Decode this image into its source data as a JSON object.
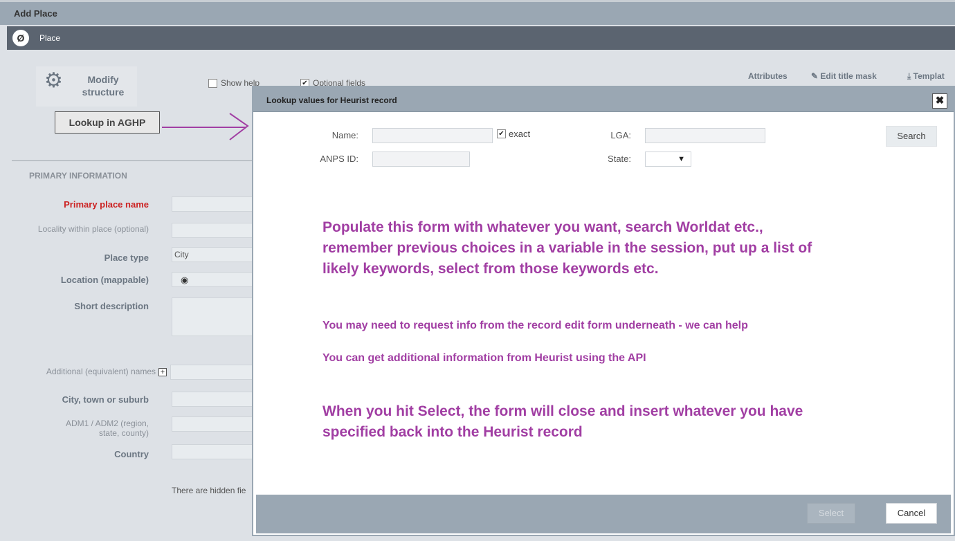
{
  "window": {
    "title": "Add Place"
  },
  "record_bar": {
    "icon_text": "Ø",
    "label": "Place"
  },
  "left_panel": {
    "modify_label": "Modify structure",
    "lookup_button": "Lookup in AGHP",
    "show_help_label": "Show help",
    "optional_fields_label": "Optional fields",
    "section_header": "PRIMARY INFORMATION",
    "fields": {
      "primary_place_name": "Primary place name",
      "locality": "Locality within place (optional)",
      "place_type": "Place type",
      "place_type_value": "City",
      "location": "Location (mappable)",
      "short_description": "Short description",
      "additional_names": "Additional (equivalent) names",
      "city_town_suburb": "City, town or suburb",
      "adm": "ADM1 / ADM2 (region, state, county)",
      "country": "Country"
    },
    "hidden_note": "There are hidden fie"
  },
  "toolbar_right": {
    "attributes": "Attributes",
    "edit_title_mask": "Edit title mask",
    "template": "Templat"
  },
  "dialog": {
    "title": "Lookup values for Heurist record",
    "close_glyph": "✖",
    "search": {
      "name_label": "Name:",
      "exact_label": "exact",
      "anps_label": "ANPS ID:",
      "lga_label": "LGA:",
      "state_label": "State:",
      "state_arrow": "▼",
      "search_button": "Search"
    },
    "messages": {
      "line1": "Populate this form with whatever you want, search Worldat etc.,",
      "line2": "remember previous choices in a variable in the session, put up a list of",
      "line3": "likely keywords, select from those keywords etc.",
      "line4": "You may need to request info from the record edit form underneath - we can help",
      "line5": "You can get additional information from Heurist using the API",
      "line6": "When you hit Select, the form will close and insert whatever you have",
      "line7": "specified back into the Heurist record"
    },
    "footer": {
      "select_button": "Select",
      "cancel_button": "Cancel"
    }
  },
  "colors": {
    "accent_purple": "#a13ea3",
    "required_red": "#cc2222",
    "header_gray": "#9aa7b3",
    "record_bar": "#5b6470"
  }
}
